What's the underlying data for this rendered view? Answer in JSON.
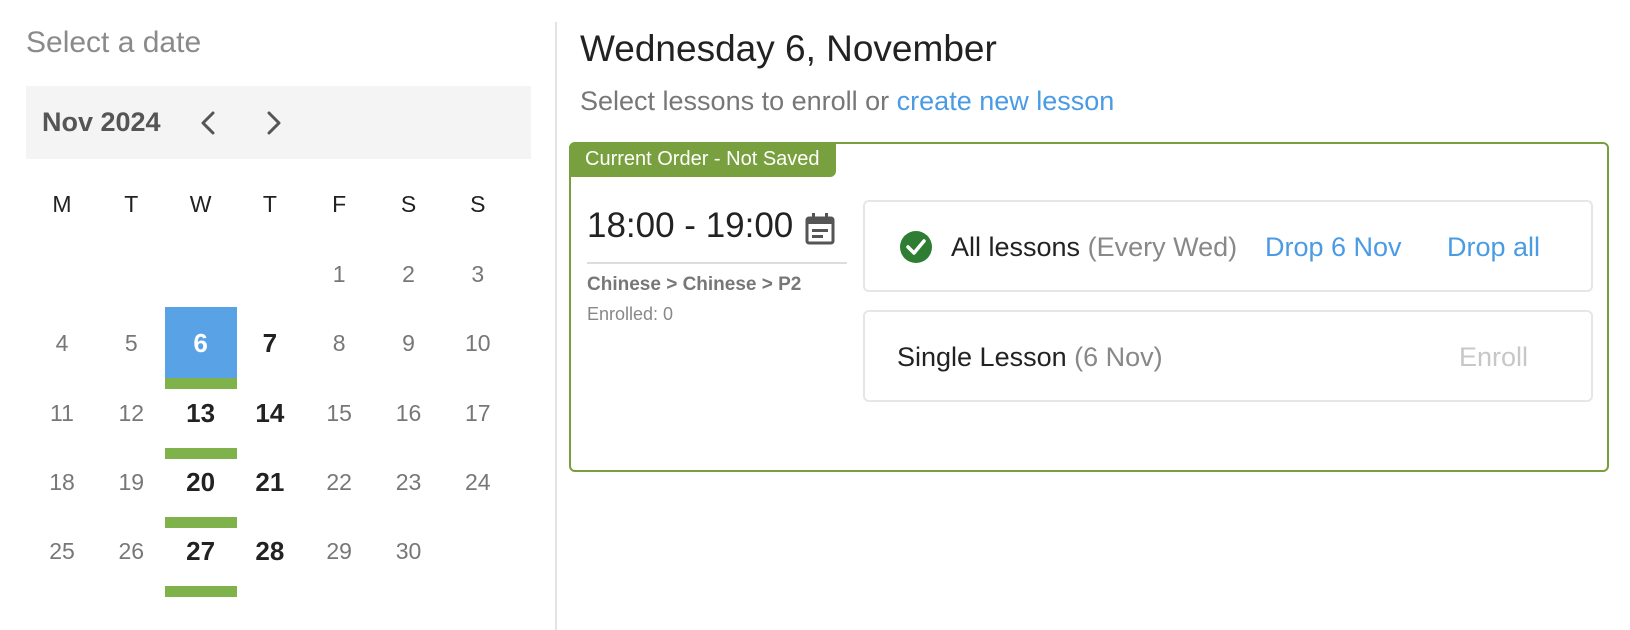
{
  "calendar": {
    "title": "Select a date",
    "month_label": "Nov 2024",
    "weekdays": [
      "M",
      "T",
      "W",
      "T",
      "F",
      "S",
      "S"
    ],
    "weeks": [
      [
        null,
        null,
        null,
        null,
        "1",
        "2",
        "3"
      ],
      [
        "4",
        "5",
        "6",
        "7",
        "8",
        "9",
        "10"
      ],
      [
        "11",
        "12",
        "13",
        "14",
        "15",
        "16",
        "17"
      ],
      [
        "18",
        "19",
        "20",
        "21",
        "22",
        "23",
        "24"
      ],
      [
        "25",
        "26",
        "27",
        "28",
        "29",
        "30",
        null
      ]
    ],
    "selected_day": "6",
    "active_days": [
      "6",
      "7",
      "13",
      "14",
      "20",
      "21",
      "27",
      "28"
    ],
    "lesson_days": [
      "6",
      "13",
      "20",
      "27"
    ]
  },
  "main": {
    "day_title": "Wednesday 6, November",
    "subtitle_prefix": "Select lessons to enroll or",
    "create_link": "create new lesson",
    "order_tag": "Current Order - Not Saved",
    "time": "18:00 - 19:00",
    "course_path": "Chinese > Chinese > P2",
    "enrolled": "Enrolled: 0",
    "option_all": {
      "label": "All lessons",
      "detail": "(Every Wed)",
      "drop_one": "Drop 6 Nov",
      "drop_all": "Drop all"
    },
    "option_single": {
      "label": "Single Lesson",
      "detail": "(6 Nov)",
      "enroll": "Enroll"
    }
  },
  "colors": {
    "accent_blue": "#5aa2e6",
    "link_blue": "#4a9be4",
    "order_green": "#79a03e",
    "lesson_green": "#7fb24a",
    "check_green": "#2e7d32"
  },
  "icons": [
    "chevron-left-icon",
    "chevron-right-icon",
    "calendar-icon",
    "check-circle-icon"
  ]
}
